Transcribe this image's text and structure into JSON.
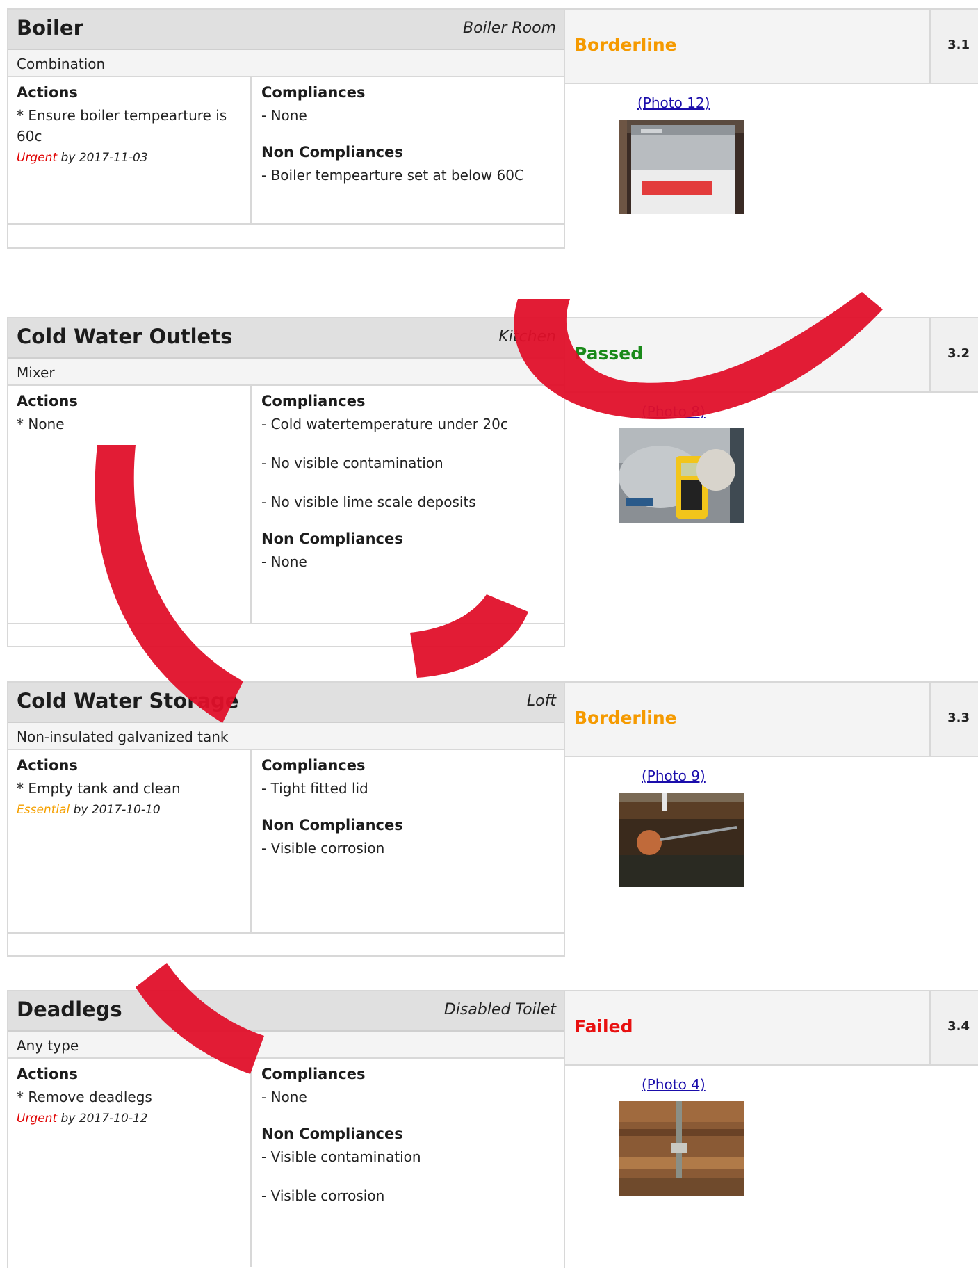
{
  "records": [
    {
      "title": "Boiler",
      "location": "Boiler Room",
      "subtype": "Combination",
      "actions_label": "Actions",
      "action": "* Ensure boiler tempearture is 60c",
      "priority": "Urgent",
      "due": " by 2017-11-03",
      "compliances_label": "Compliances",
      "compliances": [
        "- None"
      ],
      "non_compliances_label": "Non Compliances",
      "non_compliances": [
        "- Boiler tempearture set at below 60C"
      ],
      "status": "Borderline",
      "status_color": "#f59a00",
      "ref": "3.1",
      "photo_label": "(Photo 12)"
    },
    {
      "title": "Cold Water Outlets",
      "location": "Kitchen",
      "subtype": "Mixer",
      "actions_label": "Actions",
      "action": "* None",
      "priority": "",
      "due": "",
      "compliances_label": "Compliances",
      "compliances": [
        "- Cold watertemperature under 20c",
        "- No visible contamination",
        "- No visible lime scale deposits"
      ],
      "non_compliances_label": "Non Compliances",
      "non_compliances": [
        "- None"
      ],
      "status": "Passed",
      "status_color": "#1a8a1a",
      "ref": "3.2",
      "photo_label": "(Photo 8)"
    },
    {
      "title": "Cold Water Storage",
      "location": "Loft",
      "subtype": "Non-insulated galvanized tank",
      "actions_label": "Actions",
      "action": "* Empty tank and clean",
      "priority": "Essential",
      "due": " by 2017-10-10",
      "compliances_label": "Compliances",
      "compliances": [
        "- Tight fitted lid"
      ],
      "non_compliances_label": "Non Compliances",
      "non_compliances": [
        "- Visible corrosion"
      ],
      "status": "Borderline",
      "status_color": "#f59a00",
      "ref": "3.3",
      "photo_label": "(Photo 9)"
    },
    {
      "title": "Deadlegs",
      "location": "Disabled Toilet",
      "subtype": "Any type",
      "actions_label": "Actions",
      "action": "* Remove deadlegs",
      "priority": "Urgent",
      "due": " by 2017-10-12",
      "compliances_label": "Compliances",
      "compliances": [
        "- None"
      ],
      "non_compliances_label": "Non Compliances",
      "non_compliances": [
        "- Visible contamination",
        "- Visible corrosion"
      ],
      "status": "Failed",
      "status_color": "#e81010",
      "ref": "3.4",
      "photo_label": "(Photo 4)"
    }
  ],
  "colors": {
    "urgent": "#e00000",
    "essential": "#f5a000",
    "link": "#1a0dab",
    "watermark": "#e0102a"
  }
}
